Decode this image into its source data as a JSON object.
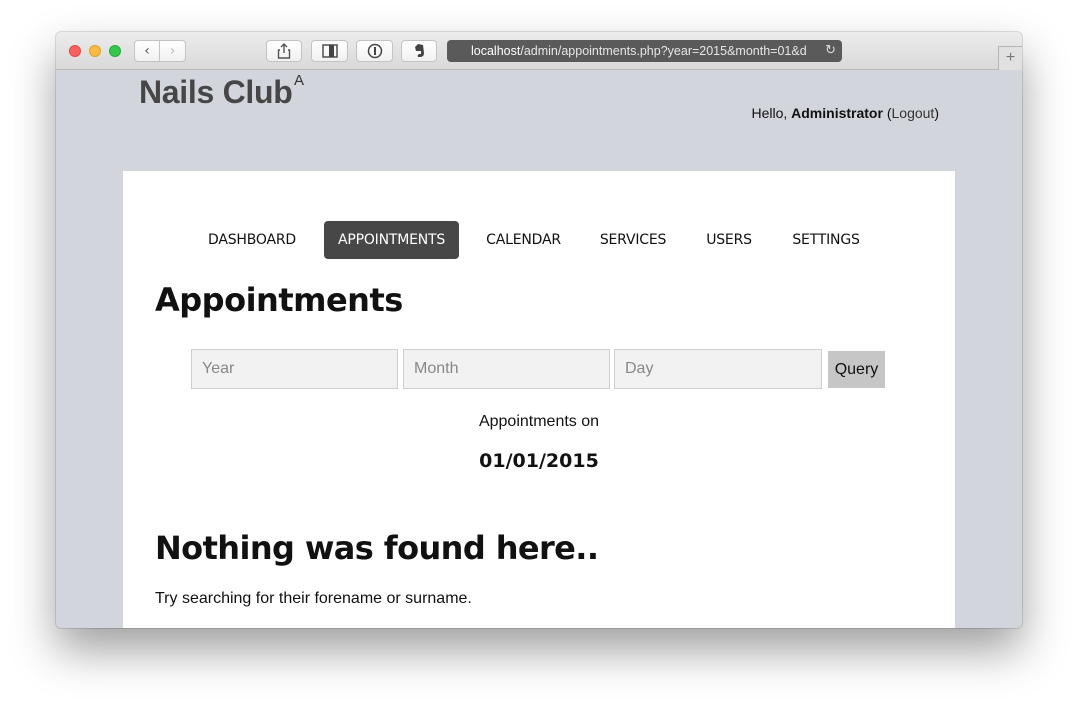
{
  "browser": {
    "url_host": "localhost",
    "url_path": "/admin/appointments.php?year=2015&month=01&d"
  },
  "site": {
    "brand": "Nails Club",
    "brand_sup": "A",
    "greeting_prefix": "Hello, ",
    "username": "Administrator",
    "logout_open": " (",
    "logout_label": "Logout",
    "logout_close": ")"
  },
  "nav": {
    "items": [
      {
        "label": "DASHBOARD"
      },
      {
        "label": "APPOINTMENTS"
      },
      {
        "label": "CALENDAR"
      },
      {
        "label": "SERVICES"
      },
      {
        "label": "USERS"
      },
      {
        "label": "SETTINGS"
      }
    ],
    "active": "APPOINTMENTS"
  },
  "main": {
    "title": "Appointments",
    "form": {
      "year_placeholder": "Year",
      "month_placeholder": "Month",
      "day_placeholder": "Day",
      "query_label": "Query"
    },
    "appointments_on_label": "Appointments on",
    "date": "01/01/2015",
    "empty_title": "Nothing was found here..",
    "empty_hint": "Try searching for their forename or surname."
  },
  "colors": {
    "page_bg": "#d2d5dc",
    "active_nav_bg": "#474747",
    "query_bg": "#c6c6c6"
  }
}
